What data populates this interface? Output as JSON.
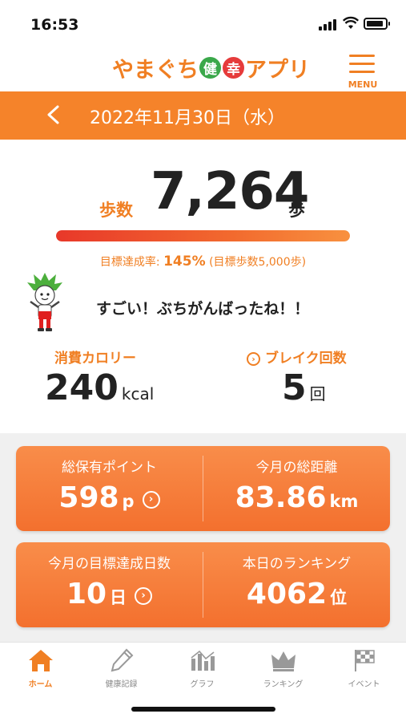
{
  "status_bar": {
    "time": "16:53"
  },
  "header": {
    "logo_pre": "やまぐち",
    "logo_badge1": "健",
    "logo_badge2": "幸",
    "logo_post": "アプリ",
    "menu_label": "MENU"
  },
  "date_bar": {
    "back_icon": "chevron-left-icon",
    "date": "2022年11月30日（水）"
  },
  "steps": {
    "label": "歩数",
    "value": "7,264",
    "unit": "歩",
    "progress_percent": 100,
    "goal_prefix": "目標達成率: ",
    "goal_percent": "145%",
    "goal_suffix": " (目標歩数5,000歩)"
  },
  "message": {
    "text": "すごい！ぶちがんばったね！！"
  },
  "calories": {
    "label": "消費カロリー",
    "value": "240",
    "unit": "kcal"
  },
  "breaks": {
    "label": "ブレイク回数",
    "value": "5",
    "unit": "回"
  },
  "cards": [
    {
      "left": {
        "label": "総保有ポイント",
        "value": "598",
        "unit": "p",
        "has_arrow": true
      },
      "right": {
        "label": "今月の総距離",
        "value": "83.86",
        "unit": "km",
        "has_arrow": false
      }
    },
    {
      "left": {
        "label": "今月の目標達成日数",
        "value": "10",
        "unit": "日",
        "has_arrow": true
      },
      "right": {
        "label": "本日のランキング",
        "value": "4062",
        "unit": "位",
        "has_arrow": false
      }
    }
  ],
  "bottom_nav": [
    {
      "label": "ホーム",
      "icon": "home-icon",
      "active": true
    },
    {
      "label": "健康記録",
      "icon": "pencil-icon",
      "active": false
    },
    {
      "label": "グラフ",
      "icon": "bar-chart-icon",
      "active": false
    },
    {
      "label": "ランキング",
      "icon": "crown-icon",
      "active": false
    },
    {
      "label": "イベント",
      "icon": "checkered-flag-icon",
      "active": false
    }
  ],
  "colors": {
    "accent": "#f07f23",
    "date_bar": "#f5832a",
    "card": "#f3702e",
    "progress": "#e8382a"
  }
}
